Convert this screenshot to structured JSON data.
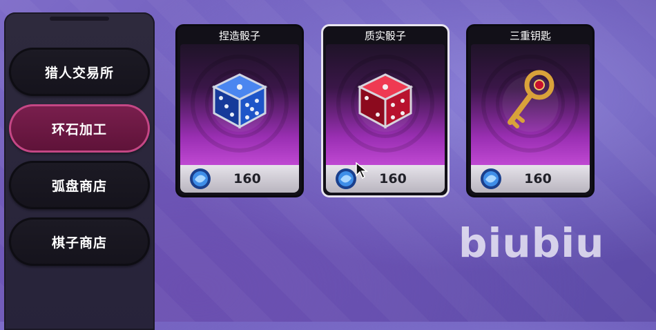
{
  "sidebar": {
    "items": [
      {
        "label": "猎人交易所",
        "active": false
      },
      {
        "label": "环石加工",
        "active": true
      },
      {
        "label": "弧盘商店",
        "active": false
      },
      {
        "label": "棋子商店",
        "active": false
      }
    ]
  },
  "shop": {
    "items": [
      {
        "name": "捏造骰子",
        "price": "160",
        "icon": "blue-dice-icon",
        "color": "#1e5fd6",
        "selected": false
      },
      {
        "name": "质实骰子",
        "price": "160",
        "icon": "red-dice-icon",
        "color": "#c8102e",
        "selected": true
      },
      {
        "name": "三重钥匙",
        "price": "160",
        "icon": "golden-key-icon",
        "color": "#d9a23a",
        "selected": false
      }
    ],
    "currency_icon": "blue-gem-icon"
  },
  "watermark": "biubiu",
  "colors": {
    "accent": "#c44785",
    "card_gradient_bottom": "#c44bd6"
  }
}
